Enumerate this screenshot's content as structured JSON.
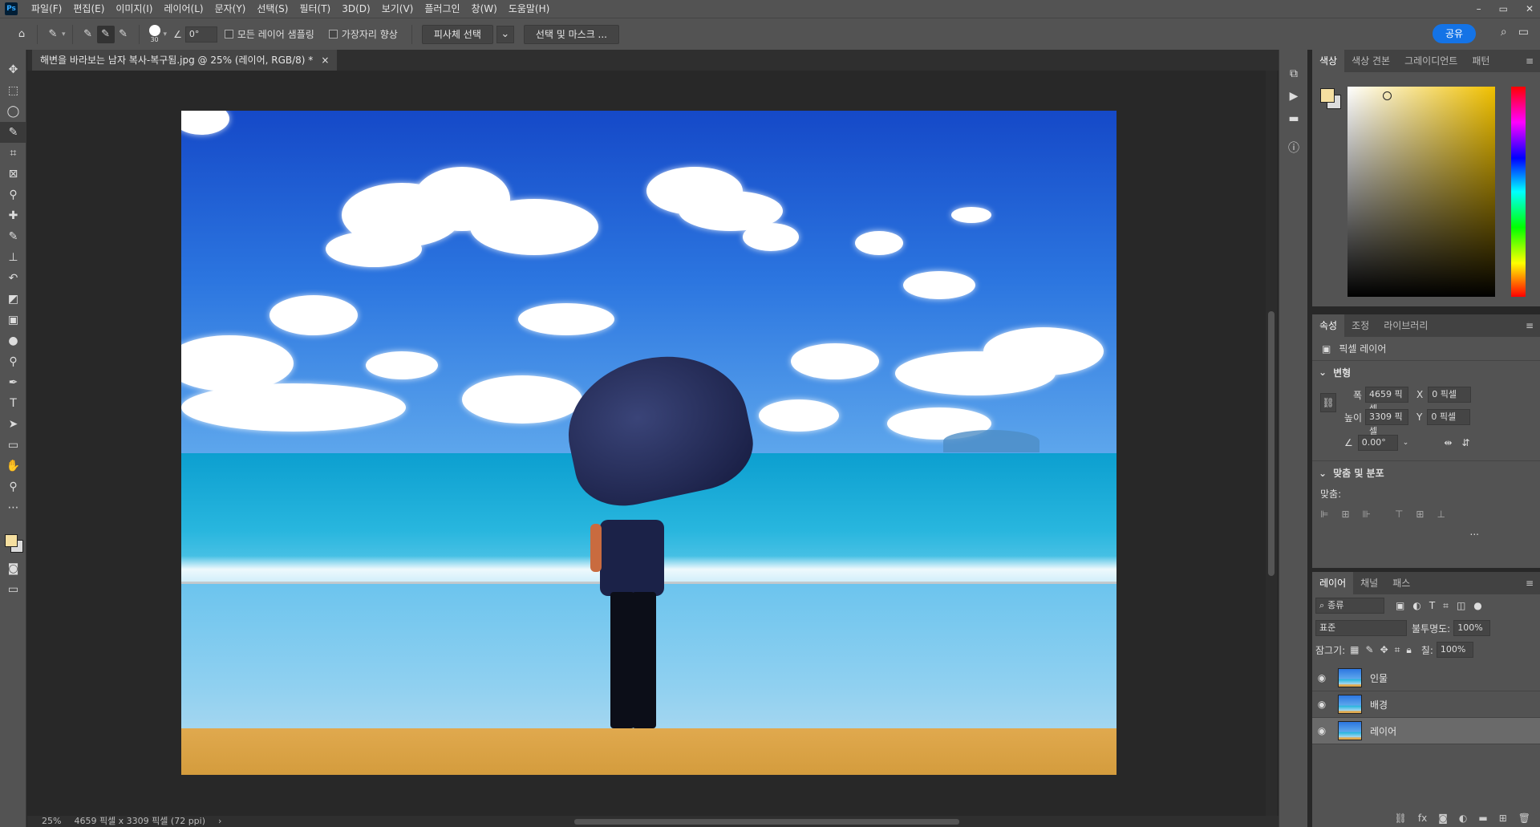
{
  "app": {
    "logo": "Ps"
  },
  "menu": [
    "파일(F)",
    "편집(E)",
    "이미지(I)",
    "레이어(L)",
    "문자(Y)",
    "선택(S)",
    "필터(T)",
    "3D(D)",
    "보기(V)",
    "플러그인",
    "창(W)",
    "도움말(H)"
  ],
  "window_controls": [
    "–",
    "▭",
    "✕"
  ],
  "options": {
    "brush_size": "30",
    "angle": "0°",
    "sample_all": "모든 레이어 샘플링",
    "enhance_edge": "가장자리 향상",
    "select_subject": "피사체 선택",
    "select_mask": "선택 및 마스크 ...",
    "share": "공유"
  },
  "tab": {
    "title": "해변을 바라보는 남자 복사-복구됨.jpg @ 25% (레이어, RGB/8) *",
    "close": "×"
  },
  "status": {
    "zoom": "25%",
    "dims": "4659 픽셀 x 3309 픽셀 (72 ppi)",
    "arrow": "›"
  },
  "color_panel": {
    "tabs": [
      "색상",
      "색상 견본",
      "그레이디언트",
      "패턴"
    ],
    "fg": "#f5dfa0",
    "bg": "#dcdcdc"
  },
  "props_panel": {
    "tabs": [
      "속성",
      "조정",
      "라이브러리"
    ],
    "type": "픽셀 레이어",
    "transform": "변형",
    "w_label": "폭",
    "w": "4659 픽셀",
    "h_label": "높이",
    "h": "3309 픽셀",
    "x_label": "X",
    "x": "0 픽셀",
    "y_label": "Y",
    "y": "0 픽셀",
    "angle": "0.00°",
    "align_title": "맞춤 및 분포",
    "align_label": "맞춤:",
    "more": "..."
  },
  "layers_panel": {
    "tabs": [
      "레이어",
      "채널",
      "패스"
    ],
    "filter": "종류",
    "blend": "표준",
    "opacity_label": "불투명도:",
    "opacity": "100%",
    "lock_label": "잠그기:",
    "fill_label": "칠:",
    "fill": "100%",
    "layers": [
      "인물",
      "배경",
      "레이어"
    ]
  }
}
